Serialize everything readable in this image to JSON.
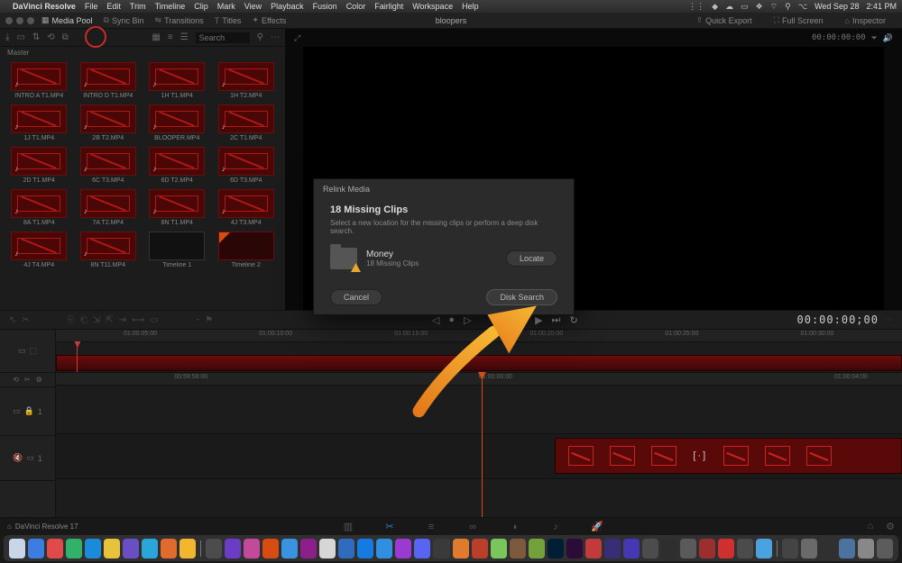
{
  "mac_menu": {
    "apple": "",
    "app": "DaVinci Resolve",
    "items": [
      "File",
      "Edit",
      "Trim",
      "Timeline",
      "Clip",
      "Mark",
      "View",
      "Playback",
      "Fusion",
      "Color",
      "Fairlight",
      "Workspace",
      "Help"
    ],
    "right": {
      "date": "Wed Sep 28",
      "time": "2:41 PM"
    }
  },
  "toolbar": {
    "items": [
      {
        "icon": "📁",
        "label": "Media Pool",
        "active": true
      },
      {
        "icon": "🎞",
        "label": "Sync Bin",
        "active": false
      },
      {
        "icon": "⇄",
        "label": "Transitions",
        "active": false
      },
      {
        "icon": "T",
        "label": "Titles",
        "active": false
      },
      {
        "icon": "✨",
        "label": "Effects",
        "active": false
      }
    ],
    "title": "bloopers",
    "right": [
      {
        "icon": "⇪",
        "label": "Quick Export"
      },
      {
        "icon": "⛶",
        "label": "Full Screen"
      },
      {
        "icon": "⌂",
        "label": "Inspector"
      }
    ]
  },
  "media_pool": {
    "search_placeholder": "Search",
    "bin": "Master",
    "clips": [
      {
        "name": "INTRO A T1.MP4",
        "kind": "offline"
      },
      {
        "name": "INTRO D T1.MP4",
        "kind": "offline"
      },
      {
        "name": "1H T1.MP4",
        "kind": "offline"
      },
      {
        "name": "1H T2.MP4",
        "kind": "offline"
      },
      {
        "name": "1J T1.MP4",
        "kind": "offline"
      },
      {
        "name": "2B T2.MP4",
        "kind": "offline"
      },
      {
        "name": "BLOOPER.MP4",
        "kind": "offline"
      },
      {
        "name": "2C T1.MP4",
        "kind": "offline"
      },
      {
        "name": "2D T1.MP4",
        "kind": "offline"
      },
      {
        "name": "6C T3.MP4",
        "kind": "offline"
      },
      {
        "name": "6D T2.MP4",
        "kind": "offline"
      },
      {
        "name": "6D T3.MP4",
        "kind": "offline"
      },
      {
        "name": "8A T1.MP4",
        "kind": "offline"
      },
      {
        "name": "7A T2.MP4",
        "kind": "offline"
      },
      {
        "name": "8N T1.MP4",
        "kind": "offline"
      },
      {
        "name": "4J T3.MP4",
        "kind": "offline"
      },
      {
        "name": "4J T4.MP4",
        "kind": "offline"
      },
      {
        "name": "8N T11.MP4",
        "kind": "offline"
      },
      {
        "name": "Timeline 1",
        "kind": "timeline"
      },
      {
        "name": "Timeline 2",
        "kind": "timeline2"
      }
    ]
  },
  "viewer": {
    "left_tc": "",
    "right_tc": "00:00:00:00",
    "dd": "⏷"
  },
  "transport": {
    "tc": "00:00:00;00"
  },
  "ruler1": [
    "01:00:05:00",
    "01:00:10:00",
    "01:00:15:00",
    "01:00:20:00",
    "01:00:25:00",
    "01:00:30:00"
  ],
  "ruler2": [
    "00:59:56:00",
    "01:00:00:00",
    "01:00:04:00"
  ],
  "tracks": {
    "v1_label": "1",
    "a1_label": "1"
  },
  "dialog": {
    "title": "Relink Media",
    "heading": "18 Missing Clips",
    "sub": "Select a new location for the missing clips or perform a deep disk search.",
    "folder_name": "Money",
    "folder_count": "18 Missing Clips",
    "locate": "Locate",
    "cancel": "Cancel",
    "disk": "Disk Search"
  },
  "pages": {
    "label": "DaVinci Resolve 17",
    "active_index": 2
  },
  "dock_colors": [
    "#c8d6e8",
    "#3b7de0",
    "#e04a4a",
    "#30b26b",
    "#1c8adb",
    "#e8c23b",
    "#6a4ec4",
    "#2aa6da",
    "#e06b2e",
    "#f2b72e",
    "#4c4c4c",
    "#6a3ec4",
    "#c34a9a",
    "#d84b11",
    "#3a93de",
    "#8d1f8d",
    "#d6d6d6",
    "#2f6cc0",
    "#167be0",
    "#2f8fe0",
    "#993bd1",
    "#5865F2",
    "#3a3a3a",
    "#e07a2e",
    "#b93f2a",
    "#7ac65b",
    "#7e5a3c",
    "#73a23c",
    "#001e36",
    "#2d0b39",
    "#c23a3a",
    "#362f78",
    "#4438b3",
    "#4c4c4c",
    "#2e2e2e",
    "#5a5a5a",
    "#9b2f2f",
    "#d02f2f",
    "#4b4b4b",
    "#4aa3df",
    "#444",
    "#6a6a6a",
    "#303030",
    "#4b739e",
    "#888",
    "#5c5c5c"
  ]
}
